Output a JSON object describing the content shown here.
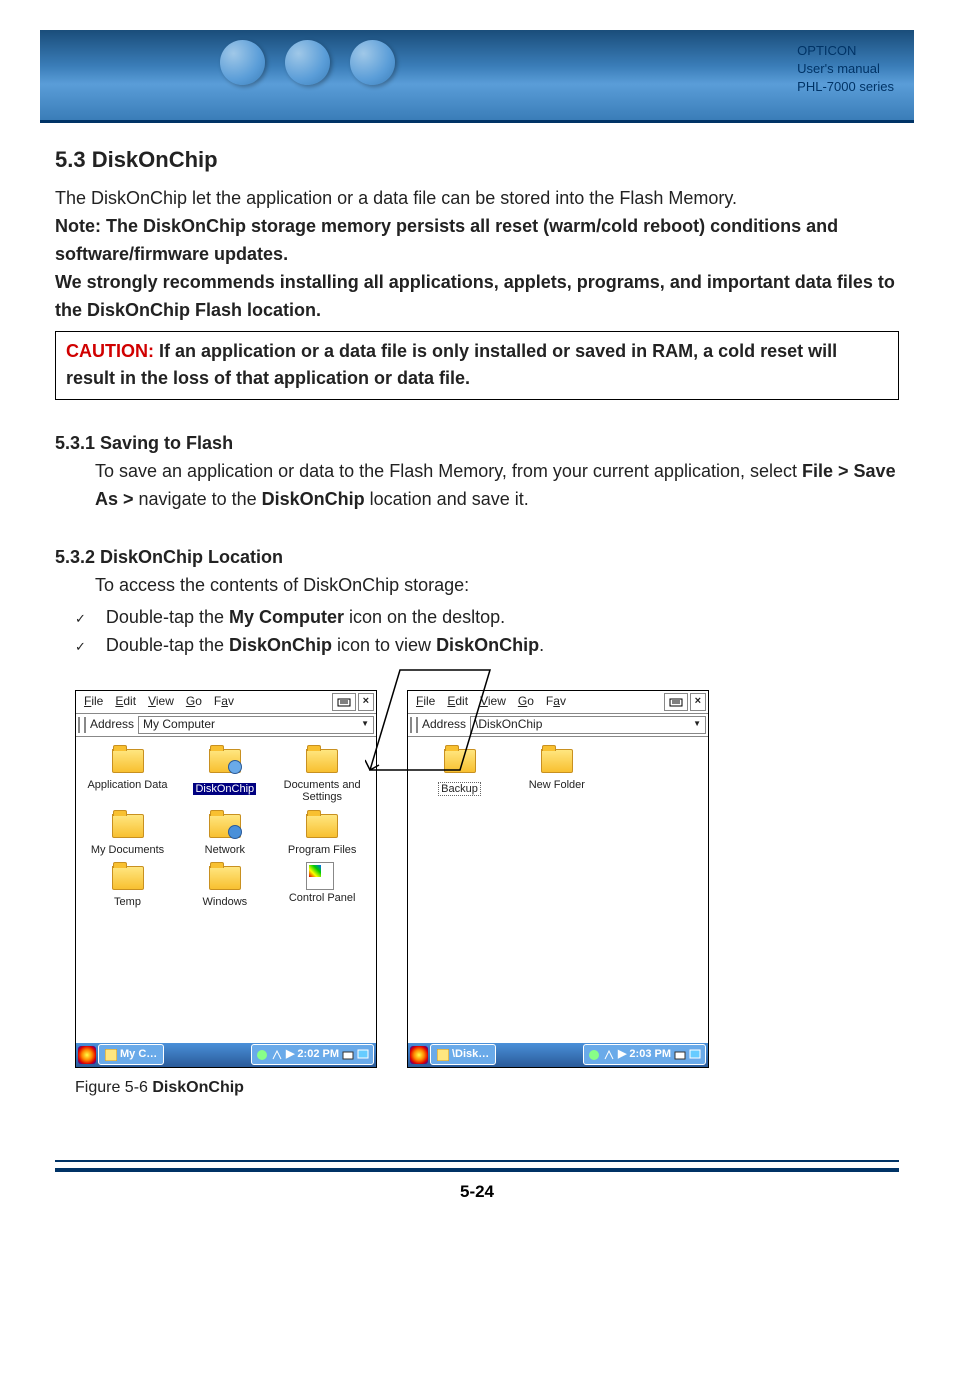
{
  "header": {
    "line1": "OPTICON",
    "line2": "User's manual",
    "line3": "PHL-7000 series"
  },
  "section": {
    "title": "5.3 DiskOnChip",
    "intro": "The DiskOnChip let the application or a data file can be stored into the Flash Memory.",
    "note_line1": "Note: The DiskOnChip storage memory persists all reset (warm/cold reboot) conditions and software/firmware updates.",
    "note_line2": "We strongly recommends installing all applications, applets, programs, and important data files to the DiskOnChip Flash location.",
    "caution_label": "CAUTION:",
    "caution_text": " If an application or a data file is only installed or saved in RAM, a cold reset will result in the loss of that application or data file."
  },
  "sub1": {
    "title": "5.3.1 Saving to Flash",
    "text_pre": "To save an application or data to the Flash Memory, from your current application, select ",
    "bold1": "File > Save As > ",
    "text_mid": "navigate to the ",
    "bold2": "DiskOnChip",
    "text_post": " location and save it."
  },
  "sub2": {
    "title": "5.3.2 DiskOnChip Location",
    "text": "To access the contents of DiskOnChip storage:",
    "bullet1_pre": "Double-tap the ",
    "bullet1_bold": "My Computer",
    "bullet1_post": " icon on the desltop.",
    "bullet2_pre": "Double-tap the ",
    "bullet2_bold1": "DiskOnChip",
    "bullet2_mid": " icon to view ",
    "bullet2_bold2": "DiskOnChip",
    "bullet2_post": "."
  },
  "menus": {
    "file": "File",
    "edit": "Edit",
    "view": "View",
    "go": "Go",
    "fav": "Fav",
    "address_label": "Address",
    "close": "×"
  },
  "window1": {
    "address_value": "My Computer",
    "icons": [
      "Application Data",
      "DiskOnChip",
      "Documents and Settings",
      "My Documents",
      "Network",
      "Program Files",
      "Temp",
      "Windows",
      "Control Panel"
    ],
    "taskbar_label": "My C…",
    "time": "2:02 PM"
  },
  "window2": {
    "address_value": "\\DiskOnChip",
    "icons": [
      "Backup",
      "New Folder"
    ],
    "taskbar_label": "\\Disk…",
    "time": "2:03 PM"
  },
  "figure": {
    "caption_pre": "Figure 5-6 ",
    "caption_bold": "DiskOnChip"
  },
  "page_number": "5-24"
}
